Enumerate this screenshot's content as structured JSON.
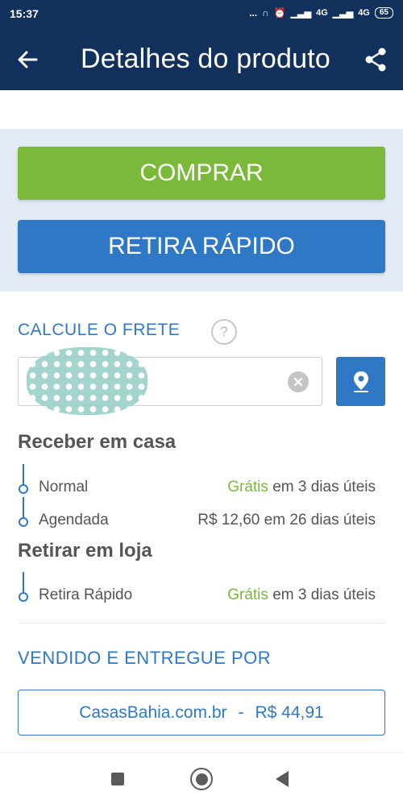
{
  "status_bar": {
    "time": "15:37",
    "dots": "...",
    "network_1": "4G",
    "network_2": "4G",
    "battery": "65"
  },
  "app_bar": {
    "title": "Detalhes do produto"
  },
  "actions": {
    "buy_label": "COMPRAR",
    "pickup_label": "RETIRA RÁPIDO"
  },
  "freight": {
    "title": "CALCULE O FRETE",
    "help": "?",
    "cep_value": "",
    "home_title": "Receber em casa",
    "home_options": [
      {
        "name": "Normal",
        "free": "Grátis",
        "detail": "em 3 dias úteis"
      },
      {
        "name": "Agendada",
        "price": "R$ 12,60 em 26 dias úteis"
      }
    ],
    "store_title": "Retirar em loja",
    "store_options": [
      {
        "name": "Retira Rápido",
        "free": "Grátis",
        "detail": "em 3 dias úteis"
      }
    ]
  },
  "seller": {
    "title": "VENDIDO E ENTREGUE POR",
    "name": "CasasBahia.com.br",
    "separator": "-",
    "price": "R$ 44,91"
  },
  "colors": {
    "navy": "#11315c",
    "green": "#7ab93a",
    "blue": "#2f78c6",
    "panel": "#e2eaf3"
  },
  "icons": [
    "back-arrow-icon",
    "share-icon",
    "help-icon",
    "clear-icon",
    "location-pin-icon"
  ]
}
